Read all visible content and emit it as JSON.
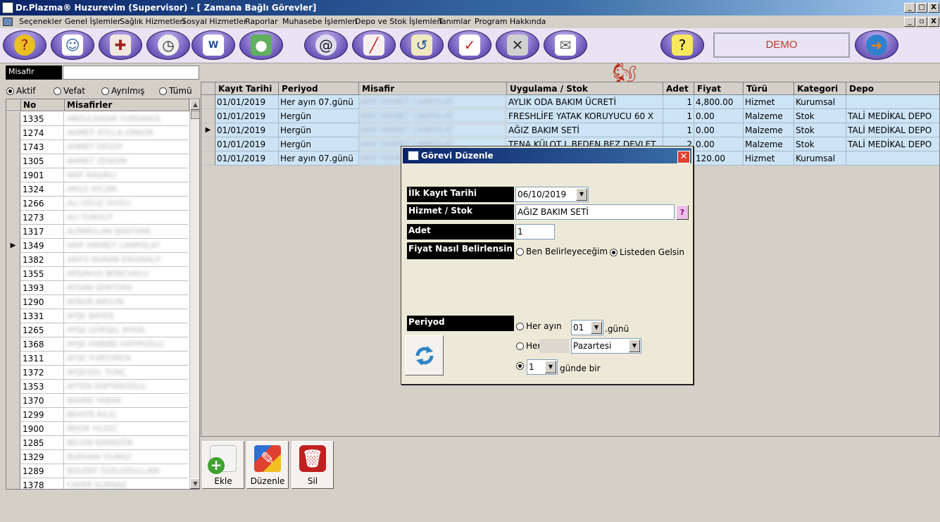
{
  "window": {
    "title": "Dr.Plazma® Huzurevim (Supervisor) - [ Zamana Bağlı Görevler]",
    "controls": [
      "_",
      "□",
      "X"
    ],
    "child_controls": [
      "_",
      "▫",
      "X"
    ]
  },
  "menu": [
    "Seçenekler",
    "Genel İşlemler",
    "Sağlık Hizmetleri",
    "Sosyal Hizmetler",
    "Raporlar",
    "Muhasebe İşlemleri",
    "Depo ve Stok İşlemleri",
    "Tanımlar",
    "Program Hakkında"
  ],
  "toolbar": {
    "icons": [
      "help-head-icon",
      "doctors-icon",
      "medical-tools-icon",
      "clock-icon",
      "word-doc-icon",
      "pills-icon",
      "spiral-icon",
      "syringe-icon",
      "clock-back-icon",
      "clipboard-icon",
      "tools-icon",
      "mail-icon",
      "squirrel-icon",
      "help-note-icon",
      "globe-exit-icon"
    ],
    "demo_label": "DEMO"
  },
  "guest_panel": {
    "label": "Misafir",
    "search_value": "",
    "filters": [
      {
        "label": "Aktif",
        "selected": true
      },
      {
        "label": "Vefat",
        "selected": false
      },
      {
        "label": "Ayrılmış",
        "selected": false
      },
      {
        "label": "Tümü",
        "selected": false
      }
    ],
    "columns": [
      "No",
      "Misafirler"
    ],
    "rows": [
      {
        "no": "1335",
        "name": "ABDULKADIR YURDAKUL",
        "current": false
      },
      {
        "no": "1274",
        "name": "AHMET ATILLA ORKON",
        "current": false
      },
      {
        "no": "1743",
        "name": "AHMET ERSOY",
        "current": false
      },
      {
        "no": "1305",
        "name": "AHMET ZENGIN",
        "current": false
      },
      {
        "no": "1901",
        "name": "AKIF KAŞIKÇI",
        "current": false
      },
      {
        "no": "1324",
        "name": "AKILE AYCAN",
        "current": false
      },
      {
        "no": "1266",
        "name": "ALI OĞUZ DOĞU",
        "current": false
      },
      {
        "no": "1273",
        "name": "ALI TURGUT",
        "current": false
      },
      {
        "no": "1317",
        "name": "ALPARSLAN ŞENTÜRK",
        "current": false
      },
      {
        "no": "1349",
        "name": "ARIF HIKMET CANPOLAT",
        "current": true
      },
      {
        "no": "1382",
        "name": "ARIFE NURAN ERGINALP",
        "current": false
      },
      {
        "no": "1355",
        "name": "ARŞAVUS BONCUKLU",
        "current": false
      },
      {
        "no": "1393",
        "name": "AYDAN ŞENTÜRK",
        "current": false
      },
      {
        "no": "1290",
        "name": "AYNUR ARGUN",
        "current": false
      },
      {
        "no": "1331",
        "name": "AYŞE BAYER",
        "current": false
      },
      {
        "no": "1265",
        "name": "AYŞE GÜRSEL AYKAL",
        "current": false
      },
      {
        "no": "1368",
        "name": "AYŞE HABIBE HATIPOĞLU",
        "current": false
      },
      {
        "no": "1311",
        "name": "AYŞE YURTOREN",
        "current": false
      },
      {
        "no": "1372",
        "name": "AYŞEGÜL TUNÇ",
        "current": false
      },
      {
        "no": "1353",
        "name": "AYTEN KAPTANOĞLU",
        "current": false
      },
      {
        "no": "1370",
        "name": "BAHRE YABAR",
        "current": false
      },
      {
        "no": "1299",
        "name": "BEHIYE KILIÇ",
        "current": false
      },
      {
        "no": "1900",
        "name": "BEKIR YILDIZ",
        "current": false
      },
      {
        "no": "1285",
        "name": "BİLGİN KARAGÖK",
        "current": false
      },
      {
        "no": "1329",
        "name": "BURHAN YILMAZ",
        "current": false
      },
      {
        "no": "1289",
        "name": "BÜLENT ÖZELOĞULLARI",
        "current": false
      },
      {
        "no": "1378",
        "name": "CAFER KURNAZ",
        "current": false
      }
    ]
  },
  "tasks_grid": {
    "columns": [
      "Kayıt Tarihi",
      "Periyod",
      "Misafir",
      "Uygulama / Stok",
      "Adet",
      "Fiyat",
      "Türü",
      "Kategori",
      "Depo"
    ],
    "rows": [
      {
        "date": "01/01/2019",
        "period": "Her ayın 07.günü",
        "guest": "ARIF HIKMET CANPOLAT",
        "item": "AYLIK ODA BAKIM ÜCRETİ",
        "qty": "1",
        "price": "4,800.00",
        "type": "Hizmet",
        "category": "Kurumsal",
        "depot": "",
        "current": false
      },
      {
        "date": "01/01/2019",
        "period": "Hergün",
        "guest": "ARIF HIKMET CANPOLAT",
        "item": "FRESHLİFE YATAK KORUYUCU 60 X",
        "qty": "1",
        "price": "0.00",
        "type": "Malzeme",
        "category": "Stok",
        "depot": "TALİ MEDİKAL DEPO",
        "current": false
      },
      {
        "date": "01/01/2019",
        "period": "Hergün",
        "guest": "ARIF HIKMET CANPOLAT",
        "item": "AĞIZ BAKIM SETİ",
        "qty": "1",
        "price": "0.00",
        "type": "Malzeme",
        "category": "Stok",
        "depot": "TALİ MEDİKAL DEPO",
        "current": true
      },
      {
        "date": "01/01/2019",
        "period": "Hergün",
        "guest": "ARIF HIKMET CANPOLAT",
        "item": "TENA KÜLOT L BEDEN BEZ DEVLET",
        "qty": "2",
        "price": "0.00",
        "type": "Malzeme",
        "category": "Stok",
        "depot": "TALİ MEDİKAL DEPO",
        "current": false
      },
      {
        "date": "01/01/2019",
        "period": "Her ayın 07.günü",
        "guest": "ARIF HIKMET CANPOLAT",
        "item": "",
        "qty": "1",
        "price": "120.00",
        "type": "Hizmet",
        "category": "Kurumsal",
        "depot": "",
        "current": false
      }
    ]
  },
  "actions": [
    {
      "label": "Ekle",
      "icon": "add-document-icon"
    },
    {
      "label": "Düzenle",
      "icon": "edit-puzzle-icon"
    },
    {
      "label": "Sil",
      "icon": "trash-icon"
    }
  ],
  "dialog": {
    "title": "Görevi Düzenle",
    "start_date_label": "İlk Kayıt Tarihi",
    "start_date_value": "06/10/2019",
    "item_label": "Hizmet / Stok",
    "item_value": "AĞIZ BAKIM SETİ",
    "lookup_label": "?",
    "qty_label": "Adet",
    "qty_value": "1",
    "price_mode_label": "Fiyat Nasıl Belirlensin",
    "price_options": [
      {
        "label": "Ben Belirleyeceğim",
        "selected": false
      },
      {
        "label": "Listeden Gelsin",
        "selected": true
      }
    ],
    "period_label": "Periyod",
    "monthly_label": "Her ayın",
    "monthly_day": "01",
    "monthly_suffix": ".günü",
    "weekly_label": "Her",
    "weekday": "Pazartesi",
    "interval_value": "1",
    "interval_suffix": "günde bir",
    "period_selected": "interval"
  }
}
